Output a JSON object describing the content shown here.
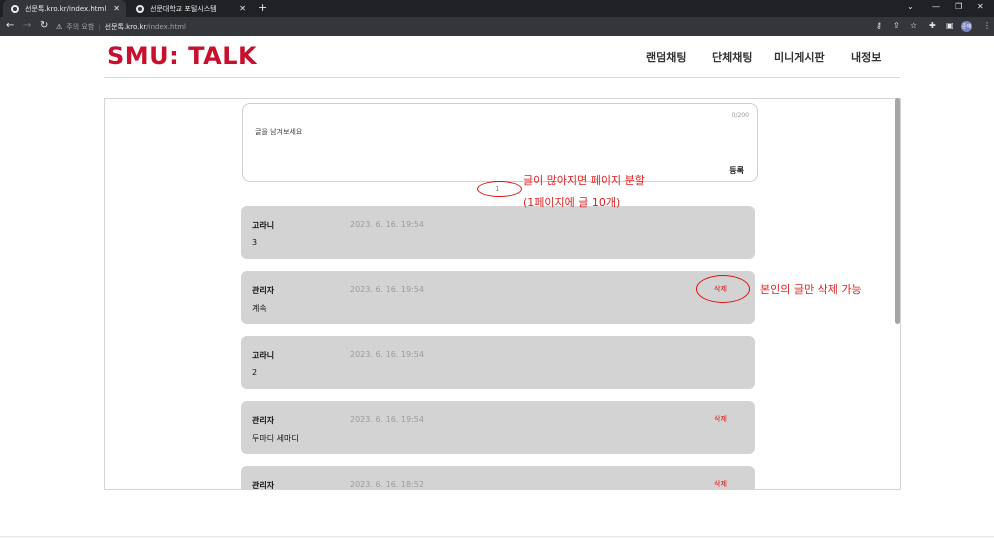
{
  "browser": {
    "tabs": [
      {
        "title": "선문톡.kro.kr/index.html",
        "active": true
      },
      {
        "title": "선문대학교 포털시스템",
        "active": false
      }
    ],
    "security_label": "주의 요함",
    "url_host": "선문톡.kro.kr",
    "url_path": "/index.html",
    "profile_label": "준재"
  },
  "header": {
    "logo": "SMU: TALK",
    "nav": [
      "랜덤채팅",
      "단체채팅",
      "미니게시판",
      "내정보"
    ]
  },
  "composer": {
    "placeholder": "글을 남겨보세요",
    "counter": "0/200",
    "submit_label": "등록"
  },
  "pager": {
    "current": "1"
  },
  "posts": [
    {
      "author": "고라니",
      "date": "2023. 6. 16. 19:54",
      "content": "3",
      "delete_label": ""
    },
    {
      "author": "관리자",
      "date": "2023. 6. 16. 19:54",
      "content": "계속",
      "delete_label": "삭제"
    },
    {
      "author": "고라니",
      "date": "2023. 6. 16. 19:54",
      "content": "2",
      "delete_label": ""
    },
    {
      "author": "관리자",
      "date": "2023. 6. 16. 19:54",
      "content": "두마디 세마디",
      "delete_label": "삭제"
    },
    {
      "author": "관리자",
      "date": "2023. 6. 16. 18:52",
      "content": "",
      "delete_label": "삭제"
    }
  ],
  "annotations": {
    "pagination_line1": "글이 많아지면 페이지 분할",
    "pagination_line2": "(1페이지에 글 10개)",
    "delete_note": "본인의 글만 삭제 가능"
  },
  "colors": {
    "brand": "#c8102e",
    "annotation": "#e02020",
    "post_bg": "#d3d3d3"
  }
}
